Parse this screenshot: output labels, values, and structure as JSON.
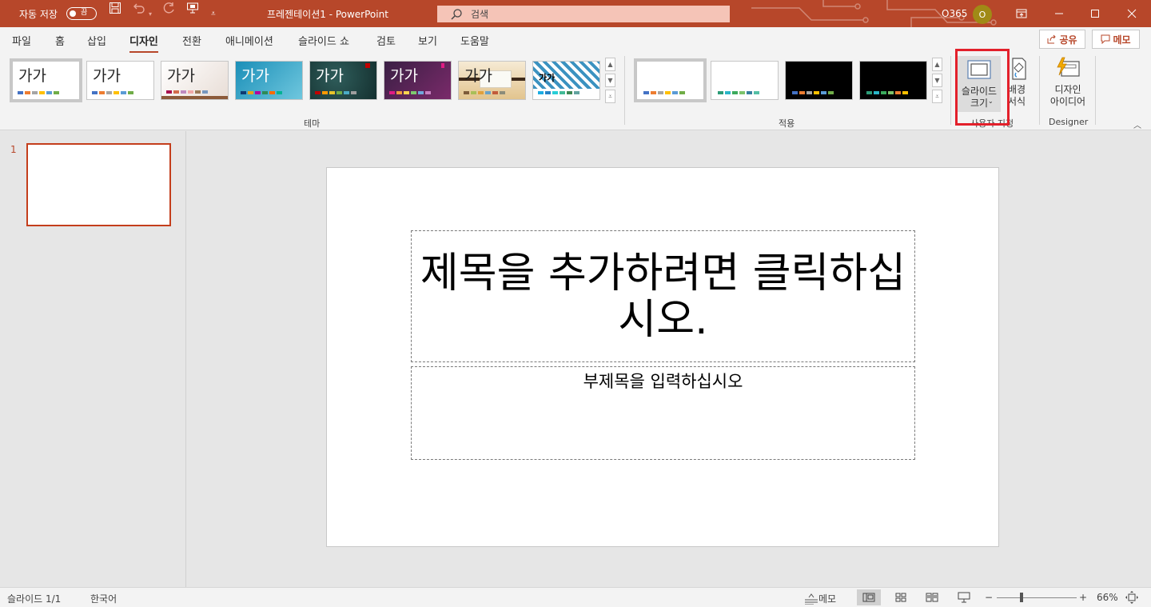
{
  "titlebar": {
    "autosave_label": "자동 저장",
    "autosave_state": "끔",
    "doc_title": "프레젠테이션1  -  PowerPoint",
    "search_placeholder": "검색",
    "account": "O365",
    "avatar_initial": "O"
  },
  "tabs": [
    "파일",
    "홈",
    "삽입",
    "디자인",
    "전환",
    "애니메이션",
    "슬라이드 쇼",
    "검토",
    "보기",
    "도움말"
  ],
  "active_tab": "디자인",
  "share_label": "공유",
  "memo_label": "메모",
  "ribbon": {
    "theme_sample": "가가",
    "themes_group_label": "테마",
    "variants_group_label": "적용",
    "slide_size_label_1": "슬라이드",
    "slide_size_label_2": "크기",
    "format_bg_label_1": "배경",
    "format_bg_label_2": "서식",
    "customize_group_label": "사용자 지정",
    "design_ideas_label_1": "디자인",
    "design_ideas_label_2": "아이디어",
    "designer_group_label": "Designer"
  },
  "thumbnail_number": "1",
  "slide": {
    "title_placeholder": "제목을 추가하려면 클릭하십시오.",
    "subtitle_placeholder": "부제목을 입력하십시오"
  },
  "statusbar": {
    "slide_counter": "슬라이드 1/1",
    "language": "한국어",
    "notes_label": "메모",
    "zoom_minus": "−",
    "zoom_plus": "+",
    "zoom_level": "66%"
  },
  "colors": {
    "accent": "#b7472a",
    "highlight": "#e3202b"
  }
}
